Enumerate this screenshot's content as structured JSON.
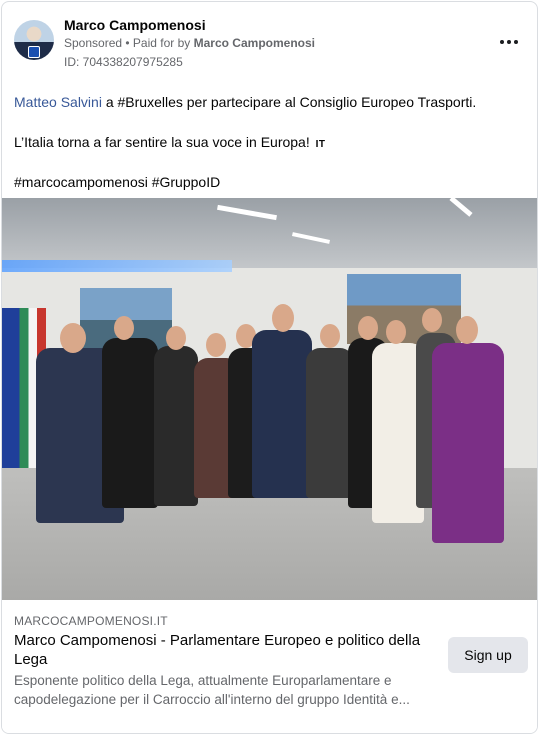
{
  "post": {
    "author": "Marco Campomenosi",
    "sponsored_label": "Sponsored",
    "separator": " • ",
    "paid_for_prefix": "Paid for by ",
    "paid_for_name": "Marco Campomenosi",
    "ad_id": "ID: 704338207975285",
    "more_icon": "more-horizontal-icon"
  },
  "content": {
    "mention": "Matteo Salvini",
    "line1_rest": " a #Bruxelles per partecipare al Consiglio Europeo Trasporti.",
    "line2": "L’Italia torna a far sentire la sua voce in Europa!",
    "line2_flag": "IT",
    "line3": "#marcocampomenosi #GruppoID"
  },
  "link_preview": {
    "domain": "MARCOCAMPOMENOSI.IT",
    "title": "Marco Campomenosi - Parlamentare Europeo e politico della Lega",
    "description": "Esponente politico della Lega, attualmente Europarlamentare e capodelegazione per il Carroccio all'interno del gruppo Identità e...",
    "cta": "Sign up"
  },
  "colors": {
    "mention": "#385898",
    "secondary_text": "#65676b",
    "button_bg": "#e4e6eb"
  }
}
